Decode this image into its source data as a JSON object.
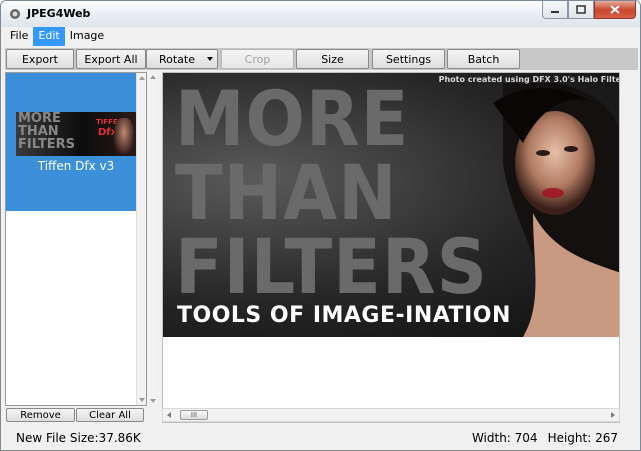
{
  "window": {
    "title": "JPEG4Web"
  },
  "menu": {
    "items": [
      "File",
      "Edit",
      "Image"
    ],
    "active": "Edit"
  },
  "toolbar": {
    "export": "Export",
    "export_all": "Export All",
    "rotate": "Rotate",
    "crop": "Crop",
    "size": "Size",
    "settings": "Settings",
    "batch": "Batch"
  },
  "thumbnails": [
    {
      "label": "Tiffen Dfx v3",
      "selected": true
    }
  ],
  "thumb_image": {
    "lines": [
      "MORE",
      "THAN",
      "FILTERS"
    ],
    "brand": "TIFFEN",
    "product": "Dfx"
  },
  "left_buttons": {
    "remove": "Remove",
    "clear_all": "Clear All"
  },
  "preview": {
    "credit": "Photo created using DFX 3.0's Halo Filte",
    "line1": "MORE",
    "line2": "THAN",
    "line3": "FILTERS",
    "tagline": "TOOLS OF IMAGE-INATION"
  },
  "scrollbar": {
    "thumb_grip": "III"
  },
  "status": {
    "file_size": "New File Size:37.86K",
    "width": "Width: 704",
    "height": "Height: 267"
  },
  "colors": {
    "selection": "#3c8fd9",
    "menu_active": "#3399ff",
    "close": "#c9462c"
  }
}
